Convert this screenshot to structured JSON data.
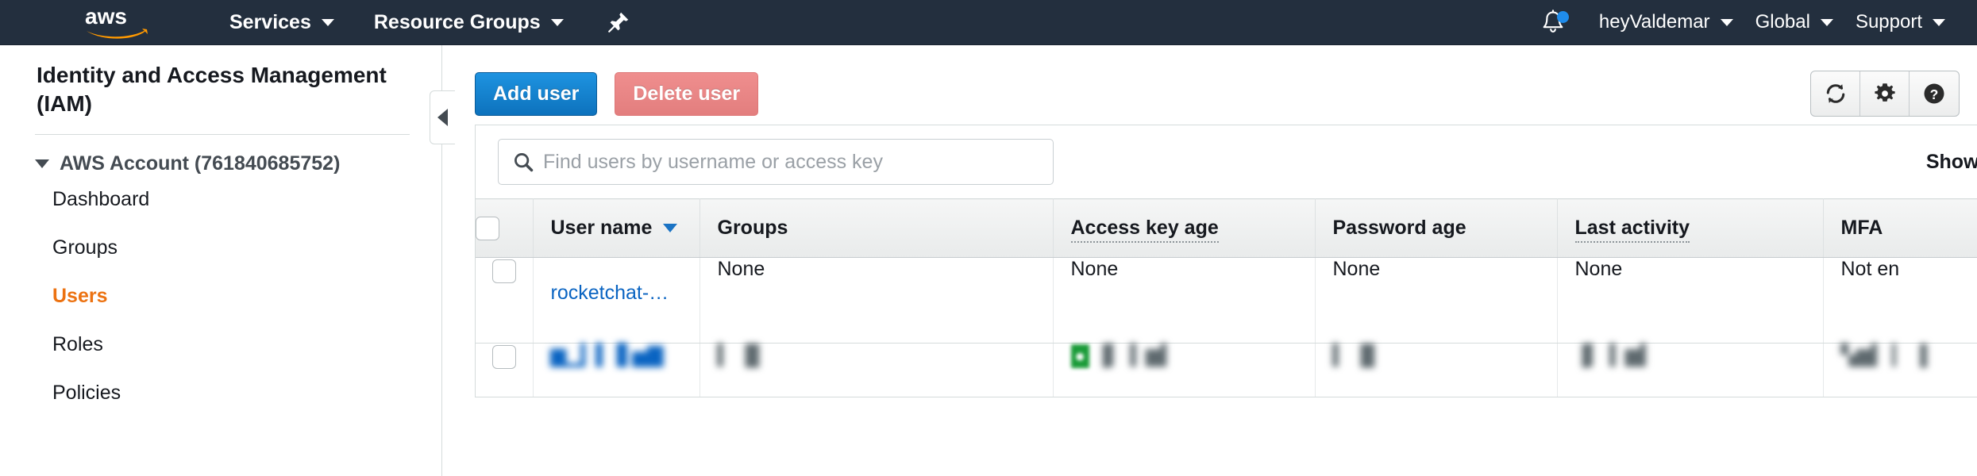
{
  "topnav": {
    "logo_alt": "aws",
    "services_label": "Services",
    "resource_groups_label": "Resource Groups",
    "pin_icon": "pushpin-icon",
    "bell_icon": "bell-icon",
    "account_label": "heyValdemar",
    "region_label": "Global",
    "support_label": "Support",
    "bg_color": "#232f3e"
  },
  "sidebar": {
    "title": "Identity and Access Management (IAM)",
    "account_label": "AWS Account (761840685752)",
    "items": [
      {
        "label": "Dashboard",
        "active": false
      },
      {
        "label": "Groups",
        "active": false
      },
      {
        "label": "Users",
        "active": true
      },
      {
        "label": "Roles",
        "active": false
      },
      {
        "label": "Policies",
        "active": false
      }
    ],
    "active_color": "#ec7211",
    "collapse_icon": "chevron-left-icon"
  },
  "toolbar": {
    "add_user_label": "Add user",
    "delete_user_label": "Delete user",
    "delete_user_disabled": true,
    "primary_color": "#0d72bd",
    "danger_color": "#e37e7e",
    "icons": [
      {
        "name": "refresh-icon"
      },
      {
        "name": "gear-icon"
      },
      {
        "name": "help-icon"
      }
    ]
  },
  "search": {
    "placeholder": "Find users by username or access key",
    "value": "",
    "icon": "search-icon"
  },
  "showing_label": "Showing",
  "table": {
    "columns": [
      {
        "key": "check",
        "label": "",
        "sorted": false,
        "tooltip": false
      },
      {
        "key": "user",
        "label": "User name",
        "sorted": true,
        "tooltip": false
      },
      {
        "key": "groups",
        "label": "Groups",
        "sorted": false,
        "tooltip": false
      },
      {
        "key": "akey",
        "label": "Access key age",
        "sorted": false,
        "tooltip": true
      },
      {
        "key": "pass",
        "label": "Password age",
        "sorted": false,
        "tooltip": false
      },
      {
        "key": "last",
        "label": "Last activity",
        "sorted": false,
        "tooltip": true
      },
      {
        "key": "mfa",
        "label": "MFA",
        "sorted": false,
        "tooltip": false
      }
    ],
    "sort_column": "User name",
    "sort_direction": "descending",
    "rows": [
      {
        "redacted": false,
        "user": "rocketchat-…",
        "groups": "None",
        "akey": "None",
        "pass": "None",
        "last": "None",
        "mfa": "Not en"
      },
      {
        "redacted": true,
        "user": "▆▁▎▍ ▋▅▇",
        "groups": "▍ ▐▌",
        "akey": "▐▎ ▍▆▍",
        "pass": "▍ ▐▌",
        "last": "▐▎ ▍▆▍",
        "mfa": "▚▆▍ ▎ ▐"
      }
    ]
  }
}
